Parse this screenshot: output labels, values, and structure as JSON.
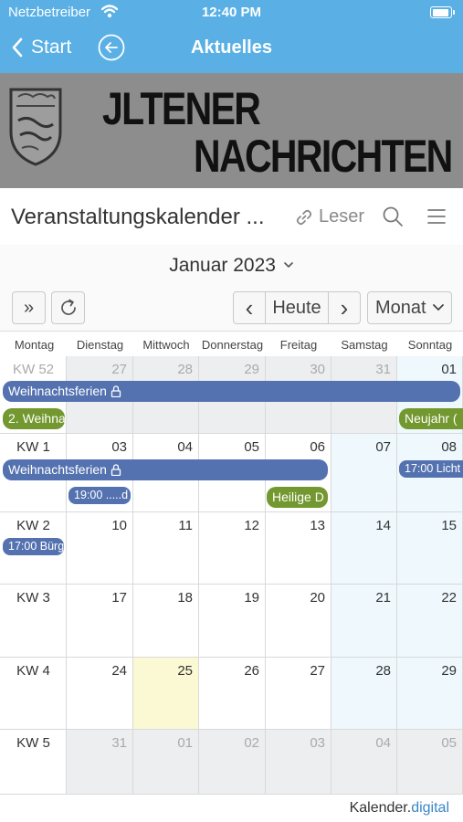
{
  "status_bar": {
    "carrier": "Netzbetreiber",
    "time": "12:40 PM",
    "battery_level": 0.9
  },
  "nav": {
    "back_label": "Start",
    "title": "Aktuelles"
  },
  "banner": {
    "line1": "JLTENER",
    "line2": "NACHRICHTEN"
  },
  "calendar_header": {
    "title": "Veranstaltungskalender ...",
    "reader_label": "Leser"
  },
  "month_selector": {
    "label": "Januar 2023"
  },
  "toolbar": {
    "expand_label": "»",
    "prev_label": "‹",
    "today_label": "Heute",
    "next_label": "›",
    "view_label": "Monat"
  },
  "weekdays": [
    "Montag",
    "Dienstag",
    "Mittwoch",
    "Donnerstag",
    "Freitag",
    "Samstag",
    "Sonntag"
  ],
  "weeks": [
    {
      "kw": "KW 52",
      "days": [
        "27",
        "28",
        "29",
        "30",
        "31",
        "01"
      ]
    },
    {
      "kw": "KW 1",
      "days": [
        "03",
        "04",
        "05",
        "06",
        "07",
        "08"
      ]
    },
    {
      "kw": "KW 2",
      "days": [
        "10",
        "11",
        "12",
        "13",
        "14",
        "15"
      ]
    },
    {
      "kw": "KW 3",
      "days": [
        "17",
        "18",
        "19",
        "20",
        "21",
        "22"
      ]
    },
    {
      "kw": "KW 4",
      "days": [
        "24",
        "25",
        "26",
        "27",
        "28",
        "29"
      ]
    },
    {
      "kw": "KW 5",
      "days": [
        "31",
        "01",
        "02",
        "03",
        "04",
        "05"
      ]
    }
  ],
  "events": {
    "ferien1": "Weihnachtsferien",
    "weihnacht2": "2. Weihna",
    "neujahr": "Neujahr (",
    "ferien2": "Weihnachtsferien",
    "time1900": "19:00 .....d",
    "licht": "17:00 Licht",
    "heilige": "Heilige D",
    "buerger": "17:00 Bürg"
  },
  "footer": {
    "brand_main": "Kalender.",
    "brand_accent": "digital"
  },
  "colors": {
    "header_blue": "#5ab0e5",
    "event_blue": "#5472b0",
    "event_green": "#72982f",
    "weekend_bg": "#eff8fc",
    "today_bg": "#fbf9d4",
    "other_month_bg": "#eceef0"
  }
}
